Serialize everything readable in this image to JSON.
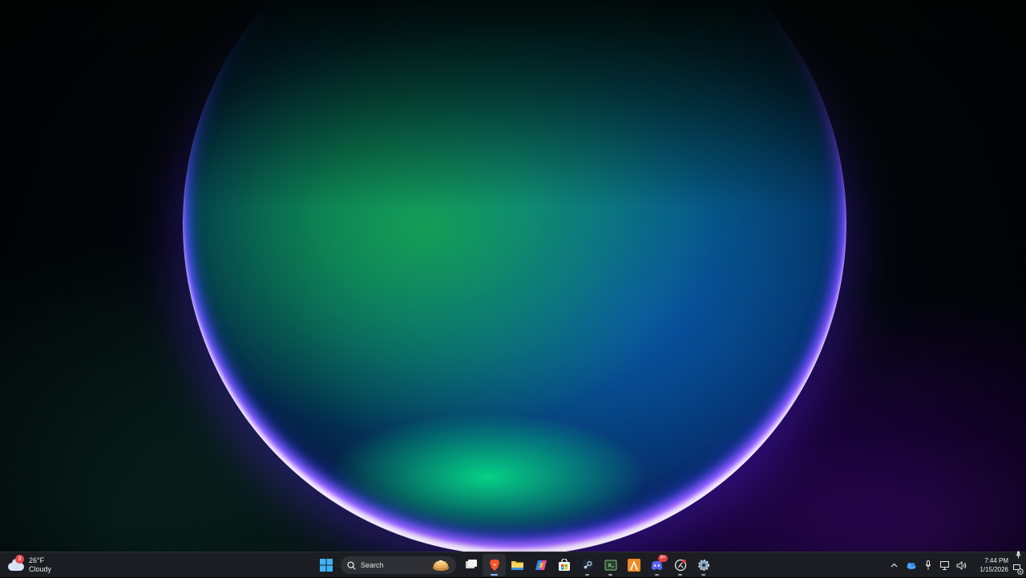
{
  "weather": {
    "temperature": "26°F",
    "condition": "Cloudy",
    "badge_count": "3",
    "icon": "cloud-icon"
  },
  "search": {
    "label": "Search"
  },
  "taskbar": {
    "apps": [
      {
        "name": "start",
        "icon": "windows-logo-icon"
      },
      {
        "name": "task-view",
        "icon": "task-view-icon"
      },
      {
        "name": "brave",
        "icon": "brave-browser-icon",
        "active": true
      },
      {
        "name": "file-explorer",
        "icon": "folder-icon"
      },
      {
        "name": "copilot",
        "icon": "copilot-icon"
      },
      {
        "name": "microsoft-store",
        "icon": "store-icon"
      },
      {
        "name": "steam",
        "icon": "steam-icon"
      },
      {
        "name": "terminal",
        "icon": "terminal-icon"
      },
      {
        "name": "vlc-like",
        "icon": "cone-icon"
      },
      {
        "name": "discord",
        "icon": "discord-icon",
        "badge": "9+"
      },
      {
        "name": "github-desktop",
        "icon": "github-icon"
      },
      {
        "name": "settings",
        "icon": "gear-icon"
      }
    ]
  },
  "tray": {
    "icons": [
      "chevron-up-icon",
      "onedrive-icon",
      "microphone-icon",
      "network-icon",
      "volume-icon"
    ],
    "time": "7:44 PM",
    "date": "1/15/2026"
  },
  "colors": {
    "taskbar": "#1c1d22",
    "accent": "#8fb8ff"
  }
}
